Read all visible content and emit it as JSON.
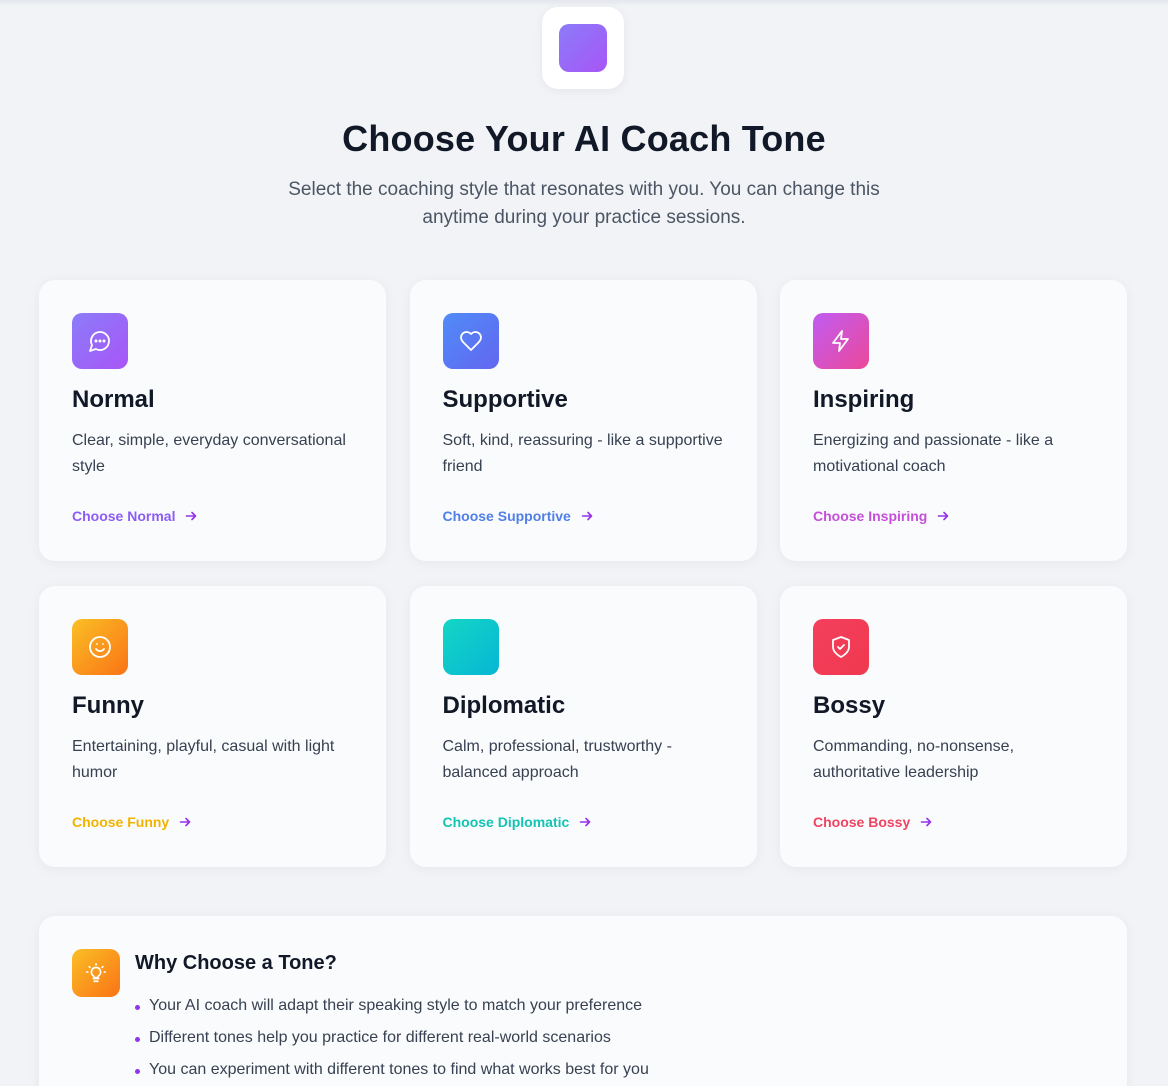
{
  "header": {
    "title": "Choose Your AI Coach Tone",
    "subtitle": "Select the coaching style that resonates with you. You can change this anytime during your practice sessions."
  },
  "tones": [
    {
      "name": "Normal",
      "description": "Clear, simple, everyday conversational style",
      "link": "Choose Normal",
      "icon": "chat-bubble-icon",
      "gradient": [
        "#8b7cf8",
        "#a855f7"
      ],
      "link_color": "#8b5cf6"
    },
    {
      "name": "Supportive",
      "description": "Soft, kind, reassuring - like a supportive friend",
      "link": "Choose Supportive",
      "icon": "heart-icon",
      "gradient": [
        "#4f8cf7",
        "#6366f1"
      ],
      "link_color": "#4f7fe8"
    },
    {
      "name": "Inspiring",
      "description": "Energizing and passionate - like a motivational coach",
      "link": "Choose Inspiring",
      "icon": "lightning-icon",
      "gradient": [
        "#c05cf3",
        "#ec4899"
      ],
      "link_color": "#c44fd8"
    },
    {
      "name": "Funny",
      "description": "Entertaining, playful, casual with light humor",
      "link": "Choose Funny",
      "icon": "smile-icon",
      "gradient": [
        "#fbbf24",
        "#f97316"
      ],
      "link_color": "#f2b300"
    },
    {
      "name": "Diplomatic",
      "description": "Calm, professional, trustworthy - balanced approach",
      "link": "Choose Diplomatic",
      "icon": "diplomatic-icon",
      "gradient": [
        "#14d6c5",
        "#06b6d4"
      ],
      "link_color": "#13c4b2"
    },
    {
      "name": "Bossy",
      "description": "Commanding, no-nonsense, authoritative leadership",
      "link": "Choose Bossy",
      "icon": "shield-check-icon",
      "gradient": [
        "#f43f5e",
        "#f0394e"
      ],
      "link_color": "#ef4462"
    }
  ],
  "arrow_color": "#9333ea",
  "why": {
    "title": "Why Choose a Tone?",
    "points": [
      "Your AI coach will adapt their speaking style to match your preference",
      "Different tones help you practice for different real-world scenarios",
      "You can experiment with different tones to find what works best for you"
    ]
  }
}
